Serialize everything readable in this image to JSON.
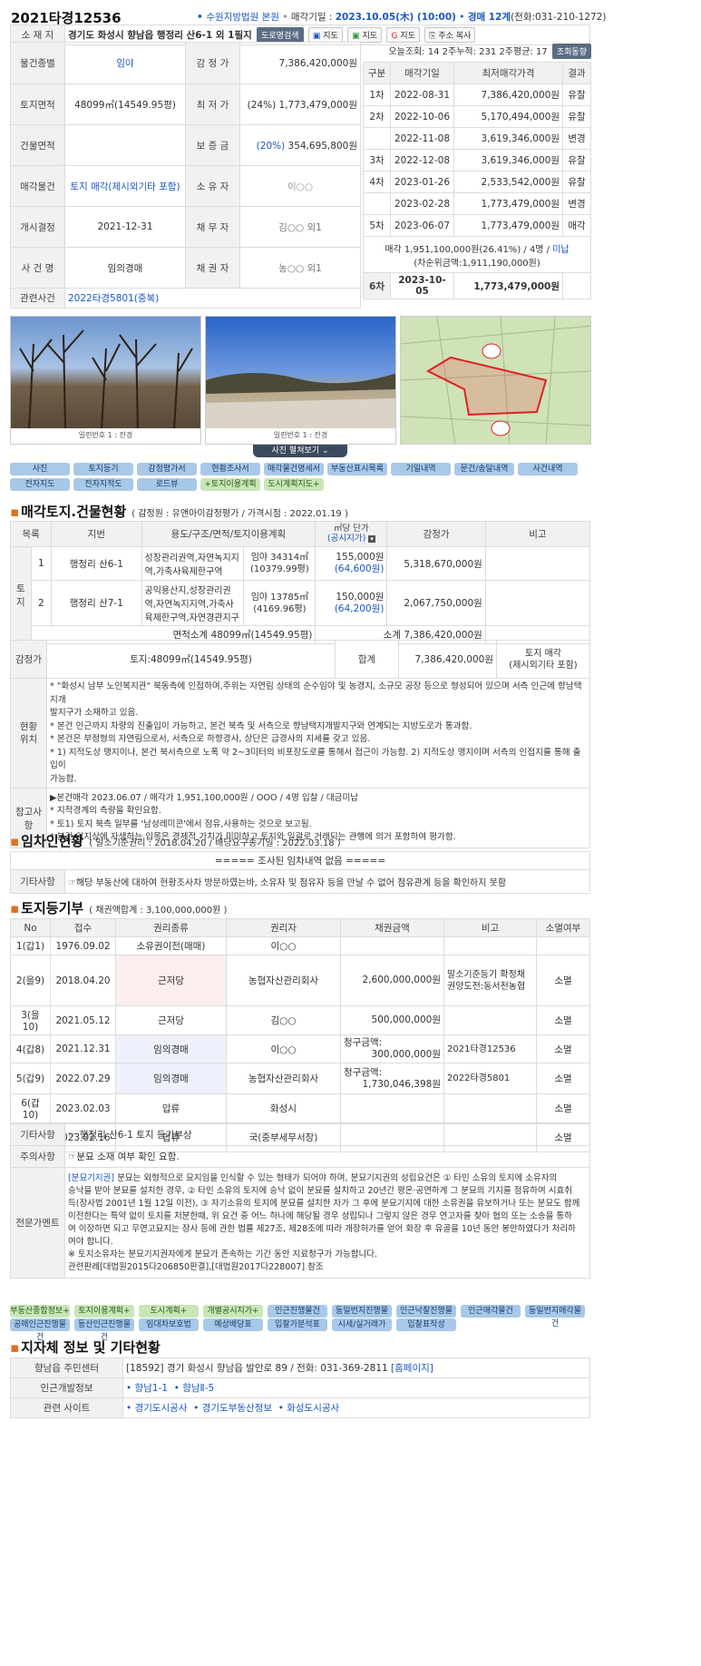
{
  "header": {
    "case_no": "2021타경12536",
    "court": "수원지방법원 본원",
    "sale_date_label": "매각기일 : ",
    "sale_date": "2023.10.05(木) (10:00)",
    "dept": "경매 12계",
    "phone": "(전화:031-210-1272)"
  },
  "info": {
    "location_label": "소 재 지",
    "location": "경기도 화성시 향남읍 행정리 산6-1 외 1필지",
    "loc_buttons": [
      "도로명검색",
      "지도",
      "지도",
      "지도",
      "주소 복사"
    ],
    "rows": [
      {
        "l1": "물건종별",
        "v1": "임야",
        "l2": "감 정 가",
        "v2": "7,386,420,000원"
      },
      {
        "l1": "토지면적",
        "v1": "48099㎡(14549.95평)",
        "l2": "최 저 가",
        "v2": "(24%) 1,773,479,000원"
      },
      {
        "l1": "건물면적",
        "v1": "",
        "l2": "보 증 금",
        "v2_pct": "(20%)",
        "v2": " 354,695,800원"
      },
      {
        "l1": "매각물건",
        "v1": "토지 매각(제시외기타 포함)",
        "l2": "소 유 자",
        "v2": "이○○"
      },
      {
        "l1": "개시결정",
        "v1": "2021-12-31",
        "l2": "채 무 자",
        "v2": "김○○ 외1"
      },
      {
        "l1": "사 건 명",
        "v1": "임의경매",
        "l2": "채 권 자",
        "v2": "농○○ 외1"
      }
    ],
    "related_label": "관련사건",
    "related": "2022타경5801(중복)"
  },
  "views": {
    "today": "오늘조회: 14",
    "two_week": "2주누적: 231",
    "avg": "2주평균: 17",
    "btn": "조회동향"
  },
  "history": {
    "headers": [
      "구분",
      "매각기일",
      "최저매각가격",
      "결과"
    ],
    "rows": [
      {
        "round": "1차",
        "date": "2022-08-31",
        "price": "7,386,420,000원",
        "result": "유찰"
      },
      {
        "round": "2차",
        "date": "2022-10-06",
        "price": "5,170,494,000원",
        "result": "유찰"
      },
      {
        "round": "",
        "date": "2022-11-08",
        "price": "3,619,346,000원",
        "result": "변경"
      },
      {
        "round": "3차",
        "date": "2022-12-08",
        "price": "3,619,346,000원",
        "result": "유찰"
      },
      {
        "round": "4차",
        "date": "2023-01-26",
        "price": "2,533,542,000원",
        "result": "유찰"
      },
      {
        "round": "",
        "date": "2023-02-28",
        "price": "1,773,479,000원",
        "result": "변경"
      },
      {
        "round": "5차",
        "date": "2023-06-07",
        "price": "1,773,479,000원",
        "result": "매각"
      }
    ],
    "sold_line1": "매각 1,951,100,000원(26.41%) / 4명 / ",
    "sold_unpaid": "미납",
    "sold_line2": "(차순위금액:1,911,190,000원)",
    "final_round": "6차",
    "final_date": "2023-10-05",
    "final_price": "1,773,479,000원"
  },
  "photos": {
    "caption1": "일련번호 1 : 전경",
    "caption2": "일련번호 1 : 전경",
    "view_all": "사진 펼쳐보기"
  },
  "doc_buttons_row1": [
    "사진",
    "토지등기",
    "감정평가서",
    "현황조사서",
    "매각물건명세서",
    "부동산표시목록",
    "기일내역",
    "문건/송달내역",
    "사건내역"
  ],
  "doc_buttons_row2": [
    "전자지도",
    "전자지적도",
    "로드뷰",
    "+토지이용계획",
    "도시계획지도+"
  ],
  "land": {
    "title": "매각토지.건물현황",
    "sub": "( 감정원 : 유앤아이감정평가 / 가격시점 : 2022.01.19 )",
    "headers": [
      "목록",
      "지번",
      "용도/구조/면적/토지이용계획",
      "㎡당 단가",
      "(공시지가)",
      "감정가",
      "비고"
    ],
    "group": "토지",
    "items": [
      {
        "no": "1",
        "lot": "행정리 산6-1",
        "use": "성장관리권역,자연녹지지역,가축사육제한구역",
        "area1": "임야 34314㎡",
        "area2": "(10379.99평)",
        "unit": "155,000원",
        "posted": "(64,600원)",
        "price": "5,318,670,000원"
      },
      {
        "no": "2",
        "lot": "행정리 산7-1",
        "use": "공익용산지,성장관리권역,자연녹지지역,가축사육제한구역,자연경관지구",
        "area1": "임야 13785㎡",
        "area2": "(4169.96평)",
        "unit": "150,000원",
        "posted": "(64,200원)",
        "price": "2,067,750,000원"
      }
    ],
    "subtotal_area": "면적소계 48099㎡(14549.95평)",
    "subtotal_price": "소계 7,386,420,000원",
    "appraisal_label": "감정가",
    "appraisal_land": "토지:48099㎡(14549.95평)",
    "appraisal_sum_label": "합계",
    "appraisal_sum": "7,386,420,000원",
    "appraisal_note1": "토지 매각",
    "appraisal_note2": "(제시외기타 포함)",
    "location_label1": "현황",
    "location_label2": "위치",
    "location_lines": [
      "* \"화성시 남부 노인복지관\" 북동측에 인접하며,주위는 자연림 상태의 순수임야 및 농경지, 소규모 공장 등으로 형성되어 있으며 서측 인근에 향남택지개",
      "발지구가 소재하고 있음.",
      "* 본건 인근까지 차량의 진출입이 가능하고, 본건 북측 및 서측으로 향남택지개발지구와 연계되는 지방도로가 통과함.",
      "* 본건은 부정형의 자연림으로서, 서측으로 하향경사, 상단은 급경사의 지세를 갖고 있음.",
      "* 1) 지적도상 맹지이나, 본건 북서측으로 노폭 약 2~3미터의 비포장도로를 통해서 접근이 가능함. 2) 지적도상 맹지이며 서측의 인접지를 통해 출입이",
      "가능함."
    ],
    "notes_label": "참고사항",
    "notes_lines": [
      "▶본건매각 2023.06.07 / 매각가 1,951,100,000원 / OOO / 4명 입찰 / 대금미납",
      "* 지적경계의 측량을 확인요함.",
      "* 토1) 토지 북측 일부를 '남성레미콘'에서 점유,사용하는 것으로 보고됨.",
      "* 본건 임지상에 자생하는 입목은 경제적 가치가 미미하고 토지와 일괄로 거래되는 관행에 의거 포함하여 평가함."
    ]
  },
  "tenant": {
    "title": "임차인현황",
    "sub": "( 말소기준권리 : 2018.04.20 / 배당요구종기일 : 2022.03.18 )",
    "none": "===== 조사된 임차내역 없음 =====",
    "etc_label": "기타사항",
    "etc": "☞해당 부동산에 대하여 현황조사차 방문하였는바, 소유자 및 점유자 등을 만날 수 없어 점유관계 등을 확인하지 못함"
  },
  "registry": {
    "title": "토지등기부",
    "sub": "( 채권액합계 : 3,100,000,000원 )",
    "headers": [
      "No",
      "접수",
      "권리종류",
      "권리자",
      "채권금액",
      "비고",
      "소멸여부"
    ],
    "rows": [
      {
        "no": "1(갑1)",
        "date": "1976.09.02",
        "type": "소유권이전(매매)",
        "holder": "이○○",
        "amt_label": "",
        "amount": "",
        "note": "",
        "status": "",
        "hl": ""
      },
      {
        "no": "2(을9)",
        "date": "2018.04.20",
        "type": "근저당",
        "holder": "농협자산관리회사",
        "amt_label": "",
        "amount": "2,600,000,000원",
        "note": "말소기준등기 확정채권양도전:동서천농협",
        "status": "소멸",
        "hl": "pink"
      },
      {
        "no": "3(을10)",
        "date": "2021.05.12",
        "type": "근저당",
        "holder": "김○○",
        "amt_label": "",
        "amount": "500,000,000원",
        "note": "",
        "status": "소멸",
        "hl": ""
      },
      {
        "no": "4(갑8)",
        "date": "2021.12.31",
        "type": "임의경매",
        "holder": "이○○",
        "amt_label": "청구금액:",
        "amount": "300,000,000원",
        "note": "2021타경12536",
        "status": "소멸",
        "hl": "blue"
      },
      {
        "no": "5(갑9)",
        "date": "2022.07.29",
        "type": "임의경매",
        "holder": "농협자산관리회사",
        "amt_label": "청구금액:",
        "amount": "1,730,046,398원",
        "note": "2022타경5801",
        "status": "소멸",
        "hl": "blue"
      },
      {
        "no": "6(갑10)",
        "date": "2023.02.03",
        "type": "압류",
        "holder": "화성시",
        "amt_label": "",
        "amount": "",
        "note": "",
        "status": "소멸",
        "hl": ""
      },
      {
        "no": "7(갑11)",
        "date": "2023.02.16",
        "type": "압류",
        "holder": "국(중부세무서장)",
        "amt_label": "",
        "amount": "",
        "note": "",
        "status": "소멸",
        "hl": ""
      }
    ],
    "etc_label": "기타사항",
    "etc": "☞ 행정리 산6-1 토지 등기부상",
    "caution_label": "주의사항",
    "caution": "☞분묘 소재 여부 확인 요함.",
    "expert_label": "전문가멘트",
    "expert_tag": "[분묘기지권]",
    "expert_lines": [
      " 분묘는 외형적으로 묘지임을 인식할 수 있는 형태가 되어야 하며, 분묘기지권의 성립요건은 ① 타인 소유의 토지에 소유자의",
      "승낙을 받아 분묘를 설치한 경우, ② 타인 소유의 토지에 승낙 없이 분묘를 설치하고 20년간 평온·공연하게 그 분묘의 기지를 점유하여 시효취",
      "득(장사법 2001년 1월 12일 이전), ③ 자기소유의 토지에 분묘를 설치한 자가 그 후에 분묘기지에 대한 소유권을 유보하거나 또는 분묘도 함께",
      "이전한다는 특약 없이 토지를 처분한때, 위 요건 중 어느 하나에 해당될 경우 성립되나 그렇지 않은 경우 연고자를 찾아 협의 또는 소송을 통하",
      "여 이장하면 되고 무연고묘지는 장사 등에 관한 법률 제27조, 제28조에 따라 개장허가를 얻어 화장 후 유골을 10년 동안 봉안하였다가 처리하",
      "여야 합니다.",
      "※ 토지소유자는 분묘기지권자에게 분묘가 존속하는 기간 동안 지료청구가 가능합니다.",
      "관련판례[대법원2015다206850판결],[대법원2017다228007] 참조"
    ]
  },
  "extra_buttons_row1": [
    "부동산종합정보+",
    "토지이용계획+",
    "도시계획+",
    "개별공시지가+",
    "인근진행물건",
    "동일번지진행물건",
    "인근낙찰진행물건",
    "인근매각물건",
    "동일번지매각물건"
  ],
  "extra_buttons_row2": [
    "공매인근진행물건",
    "동산인근진행물건",
    "임대차보호법",
    "예상배당표",
    "입찰가분석표",
    "시세/실거래가",
    "입찰표작성"
  ],
  "local": {
    "title": "지자체 정보 및 기타현황",
    "center_label": "향남읍 주민센터",
    "center": "[18592] 경기 화성시 향남읍 발안로 89 / 전화: 031-369-2811 ",
    "homepage": "[홈페이지]",
    "dev_label": "인근개발정보",
    "dev": [
      "향남1-1",
      "향남Ⅱ-5"
    ],
    "sites_label": "관련 사이트",
    "sites": [
      "경기도시공사",
      "경기도부동산정보",
      "화성도시공사"
    ]
  },
  "colors": {
    "accent": "#e07020",
    "link": "#1a56c4",
    "button": "#a9c8e8",
    "label_bg": "#f1f1f1"
  }
}
